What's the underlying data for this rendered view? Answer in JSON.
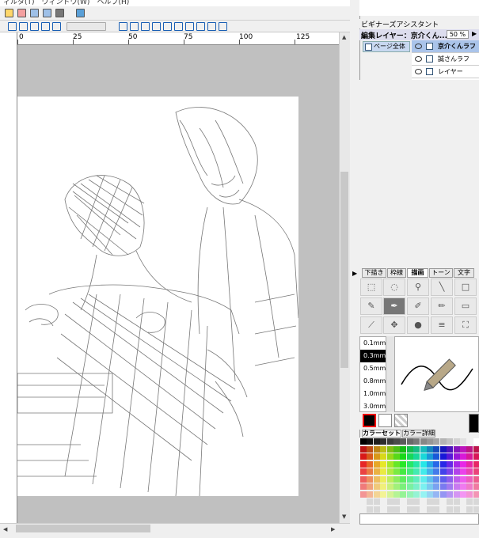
{
  "menubar": {
    "text": "ィルタ(T)　ウィンドウ(W)　ヘルプ(H)"
  },
  "ruler": {
    "marks": [
      "0",
      "25",
      "50",
      "75",
      "100",
      "125"
    ]
  },
  "panel": {
    "assistant_title": "ビギナーズアシスタント",
    "edit_layer_label": "編集レイヤー：京介くん...",
    "zoom": "50 %",
    "page_button": "ページ全体",
    "layers": [
      "京介くんラフ",
      "誠さんラフ",
      "レイヤー"
    ]
  },
  "tool_tabs": [
    "下描き",
    "枠線",
    "描画",
    "トーン",
    "文字"
  ],
  "active_tab": "描画",
  "brush_sizes": [
    "0.1mm",
    "0.3mm",
    "0.5mm",
    "0.8mm",
    "1.0mm",
    "3.0mm"
  ],
  "selected_brush_size": "0.3mm",
  "color_tabs": [
    "カラーセット",
    "カラー詳細"
  ],
  "colors": {
    "canvas_bg": "#c0c0c0",
    "selected_layer": "#aac4ea",
    "foreground": "#000000",
    "background": "#ffffff"
  }
}
